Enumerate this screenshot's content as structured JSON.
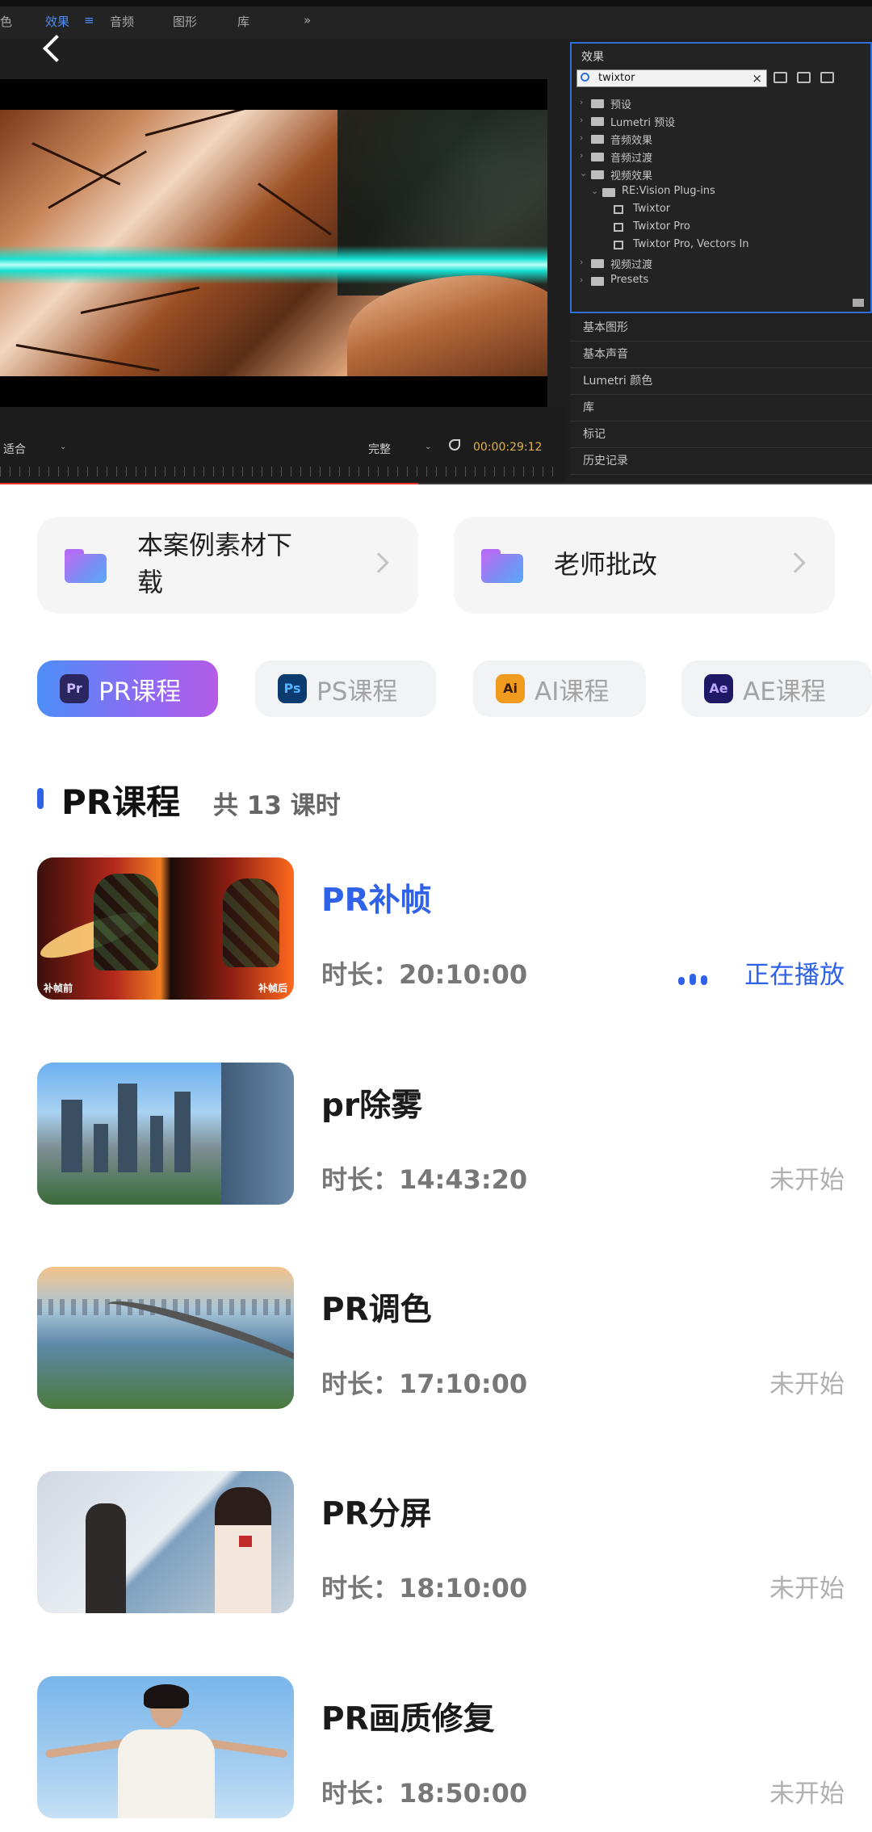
{
  "player": {
    "menu": [
      "色",
      "效果",
      "音频",
      "图形",
      "库",
      "»"
    ],
    "active_menu_index": 1,
    "fit_label": "适合",
    "quality_label": "完整",
    "timecode": "00:00:29:12",
    "progress_percent": 48,
    "effects_panel": {
      "title": "效果",
      "search_value": "twixtor",
      "tree": [
        {
          "label": "预设",
          "level": 0,
          "type": "folder"
        },
        {
          "label": "Lumetri 预设",
          "level": 0,
          "type": "folder"
        },
        {
          "label": "音频效果",
          "level": 0,
          "type": "folder"
        },
        {
          "label": "音频过渡",
          "level": 0,
          "type": "folder"
        },
        {
          "label": "视频效果",
          "level": 0,
          "type": "folder"
        },
        {
          "label": "RE:Vision Plug-ins",
          "level": 1,
          "type": "folder"
        },
        {
          "label": "Twixtor",
          "level": 2,
          "type": "effect"
        },
        {
          "label": "Twixtor Pro",
          "level": 2,
          "type": "effect"
        },
        {
          "label": "Twixtor Pro, Vectors In",
          "level": 2,
          "type": "effect"
        },
        {
          "label": "视频过渡",
          "level": 0,
          "type": "folder"
        },
        {
          "label": "Presets",
          "level": 0,
          "type": "folder"
        }
      ]
    },
    "side_panels": [
      "基本图形",
      "基本声音",
      "Lumetri 颜色",
      "库",
      "标记",
      "历史记录"
    ]
  },
  "resources": {
    "download_label": "本案例素材下\n载",
    "review_label": "老师批改"
  },
  "tabs": [
    {
      "icon": "Pr",
      "label": "PR课程",
      "active": true,
      "icon_color": "#2b2560",
      "icon_text_color": "#c8b8ff"
    },
    {
      "icon": "Ps",
      "label": "PS课程",
      "active": false,
      "icon_color": "#0b3b6f",
      "icon_text_color": "#4fb3ff"
    },
    {
      "icon": "Ai",
      "label": "AI课程",
      "active": false,
      "icon_color": "#f09a1e",
      "icon_text_color": "#3b1d00"
    },
    {
      "icon": "Ae",
      "label": "AE课程",
      "active": false,
      "icon_color": "#1f1865",
      "icon_text_color": "#b9a7ff"
    }
  ],
  "section": {
    "title": "PR课程",
    "count": "共 13 课时"
  },
  "lessons": [
    {
      "title": "PR补帧",
      "duration": "时长：20:10:00",
      "status": "正在播放",
      "playing": true,
      "thumb_captions": [
        "补帧前",
        "补帧后"
      ]
    },
    {
      "title": "pr除雾",
      "duration": "时长：14:43:20",
      "status": "未开始",
      "playing": false
    },
    {
      "title": "PR调色",
      "duration": "时长：17:10:00",
      "status": "未开始",
      "playing": false
    },
    {
      "title": "PR分屏",
      "duration": "时长：18:10:00",
      "status": "未开始",
      "playing": false
    },
    {
      "title": "PR画质修复",
      "duration": "时长：18:50:00",
      "status": "未开始",
      "playing": false
    }
  ],
  "colors": {
    "accent": "#2f62e8",
    "progress": "#e8332b",
    "muted_status": "#b0b0b0"
  }
}
